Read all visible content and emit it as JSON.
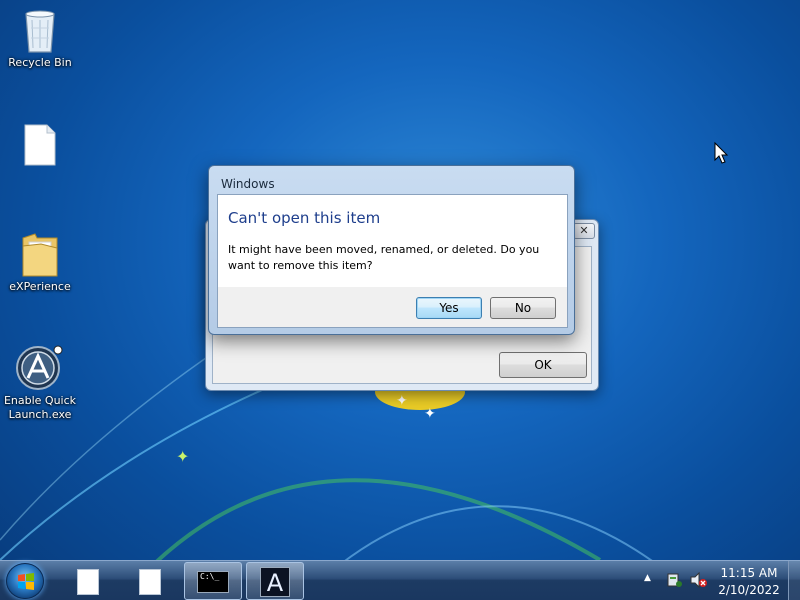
{
  "desktop": {
    "icons": [
      {
        "label": "Recycle Bin",
        "icon": "recycle-bin-icon"
      },
      {
        "label": "",
        "icon": "document-icon"
      },
      {
        "label": "eXPerience",
        "icon": "folder-icon"
      },
      {
        "label": "Enable Quick Launch.exe",
        "icon": "app-icon"
      }
    ]
  },
  "dialog_back": {
    "close_glyph": "✕",
    "ok_label": "OK"
  },
  "dialog_front": {
    "title": "Windows",
    "heading": "Can't open this item",
    "message": "It might have been moved, renamed, or deleted. Do you want to remove this item?",
    "yes_label": "Yes",
    "no_label": "No"
  },
  "taskbar": {
    "cmd_glyph": "C:\\_",
    "app_glyph": "A",
    "time": "11:15 AM",
    "date": "2/10/2022",
    "tray_chevron": "▲"
  },
  "colors": {
    "desktop_bg": "#1466be",
    "heading": "#1e3e8c"
  }
}
